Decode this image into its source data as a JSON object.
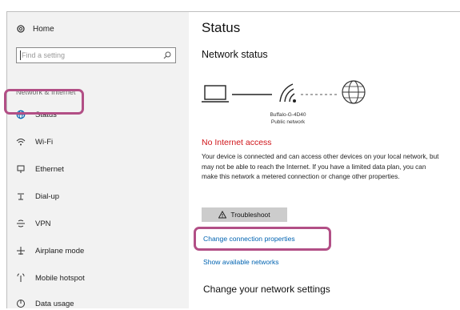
{
  "sidebar": {
    "home_label": "Home",
    "search_placeholder": "Find a setting",
    "section_title": "Network & Internet",
    "items": [
      {
        "label": "Status",
        "icon": "globe-icon"
      },
      {
        "label": "Wi-Fi",
        "icon": "wifi-icon"
      },
      {
        "label": "Ethernet",
        "icon": "ethernet-icon"
      },
      {
        "label": "Dial-up",
        "icon": "phone-icon"
      },
      {
        "label": "VPN",
        "icon": "vpn-icon"
      },
      {
        "label": "Airplane mode",
        "icon": "airplane-icon"
      },
      {
        "label": "Mobile hotspot",
        "icon": "hotspot-icon"
      },
      {
        "label": "Data usage",
        "icon": "data-usage-icon"
      }
    ]
  },
  "main": {
    "title": "Status",
    "network_status_heading": "Network status",
    "network_name": "Buffalo-G-4D40",
    "network_type": "Public network",
    "no_internet": "No Internet access",
    "description": "Your device is connected and can access other devices on your local network, but may not be able to reach the Internet. If you have a limited data plan, you can make this network a metered connection or change other properties.",
    "troubleshoot_label": "Troubleshoot",
    "change_connection_link": "Change connection properties",
    "show_networks_link": "Show available networks",
    "change_settings_heading": "Change your network settings"
  },
  "colors": {
    "accent_link": "#0063b1",
    "error_red": "#d0161b",
    "highlight": "#b24f86",
    "sidebar_bg": "#f2f2f2"
  }
}
